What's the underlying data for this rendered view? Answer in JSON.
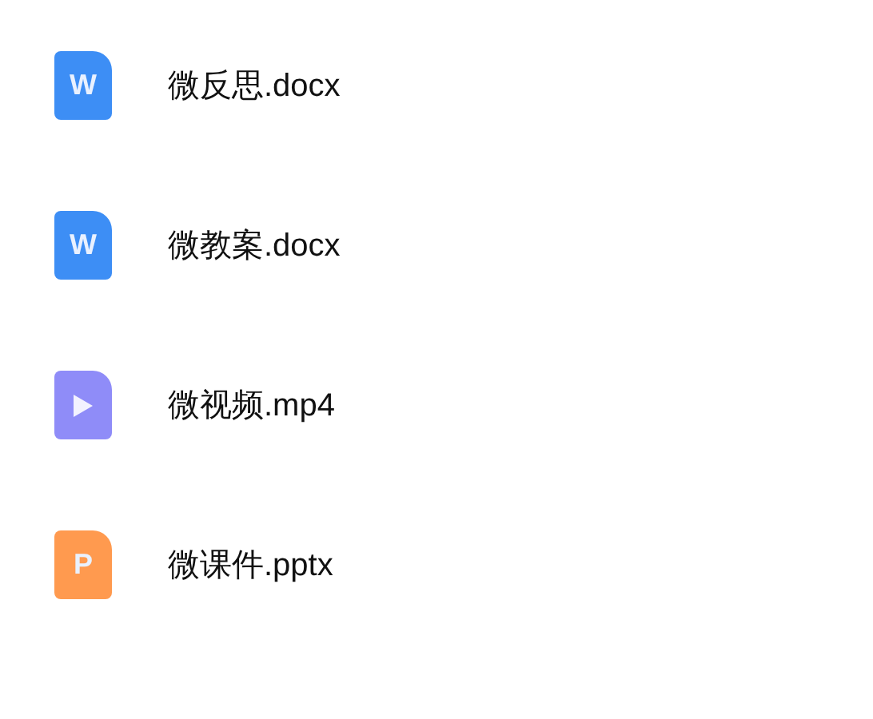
{
  "files": [
    {
      "name": "微反思.docx",
      "kind": "document",
      "letter": "W",
      "color": "#3d8ef5"
    },
    {
      "name": "微教案.docx",
      "kind": "document",
      "letter": "W",
      "color": "#3d8ef5"
    },
    {
      "name": "微视频.mp4",
      "kind": "video",
      "color": "#8f8cf8"
    },
    {
      "name": "微课件.pptx",
      "kind": "document",
      "letter": "P",
      "color": "#ff9a4f"
    }
  ]
}
